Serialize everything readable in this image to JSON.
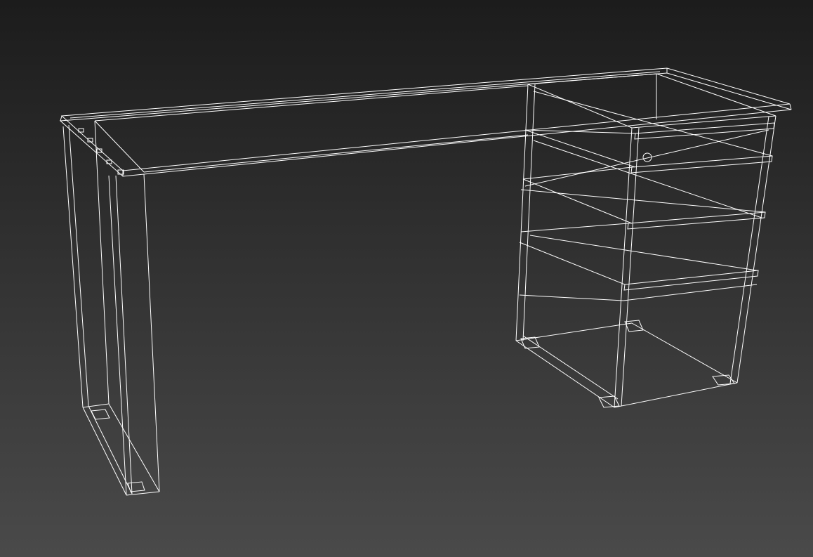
{
  "viewport": {
    "colors": {
      "background_top": "#1c1c1c",
      "background_bottom": "#4a4a4a",
      "wire": "#ffffff"
    }
  }
}
